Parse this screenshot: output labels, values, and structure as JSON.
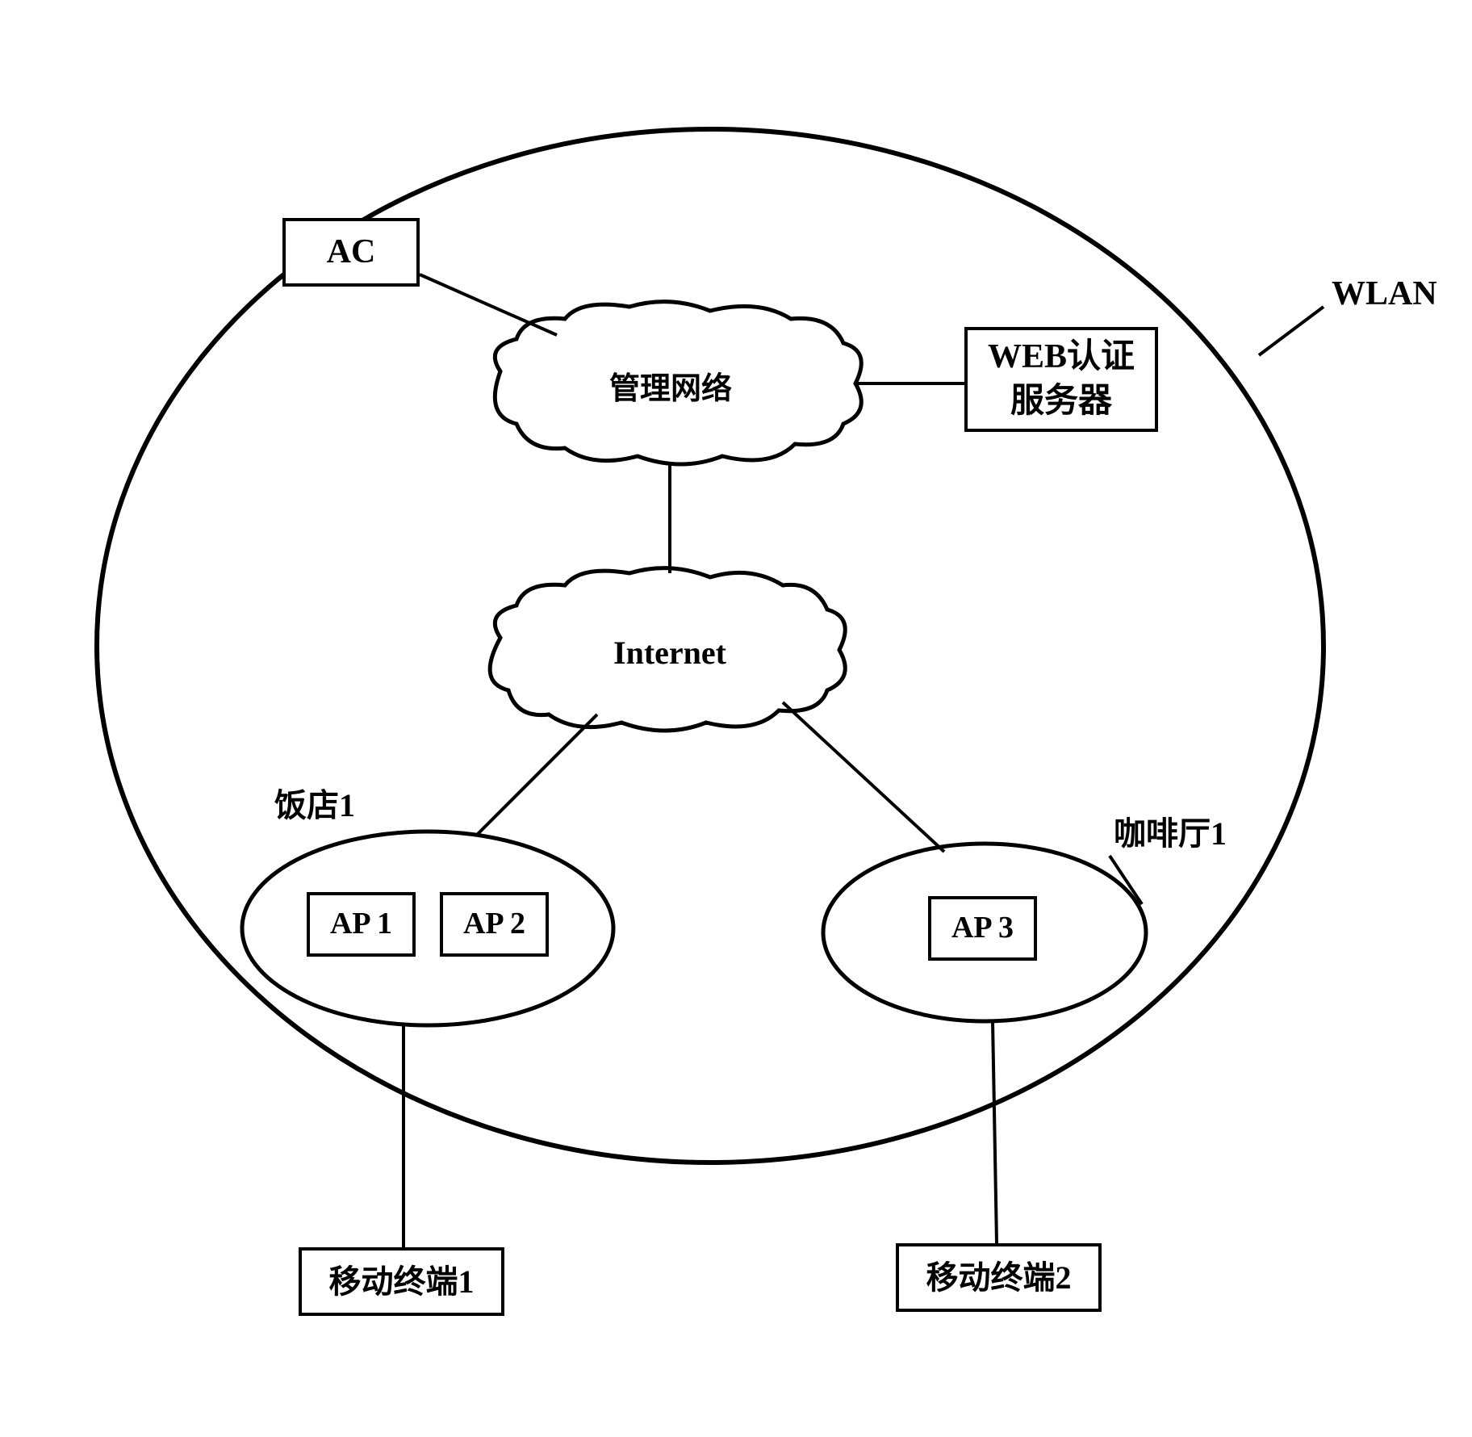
{
  "labels": {
    "wlan": "WLAN",
    "ac": "AC",
    "management_network": "管理网络",
    "web_auth_server": "WEB认证\n服务器",
    "internet": "Internet",
    "hotel": "饭店1",
    "cafe": "咖啡厅1",
    "ap1": "AP 1",
    "ap2": "AP 2",
    "ap3": "AP 3",
    "mobile_terminal_1": "移动终端1",
    "mobile_terminal_2": "移动终端2"
  },
  "diagram": {
    "type": "network_topology",
    "description": "WLAN network architecture showing AC (Access Controller), WEB authentication server, management network, Internet, and access points in hotel and cafe locations with mobile terminals"
  }
}
